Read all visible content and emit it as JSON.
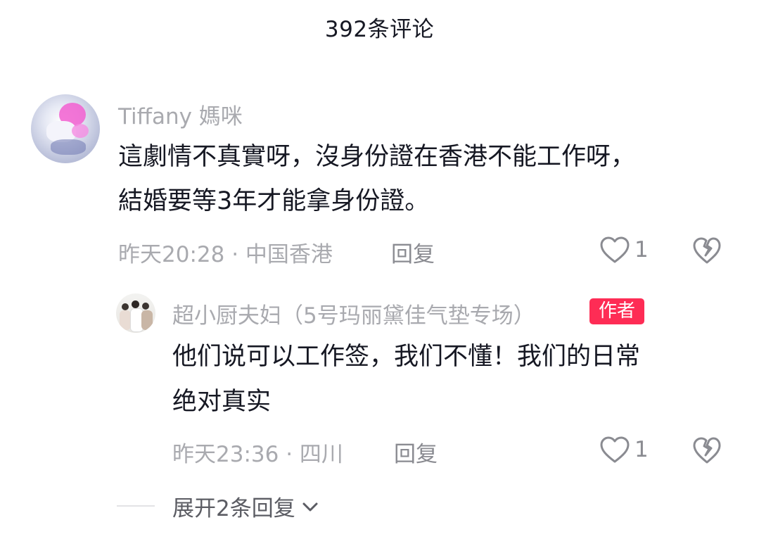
{
  "header": {
    "title": "392条评论"
  },
  "comment": {
    "username": "Tiffany 媽咪",
    "text_line1": "這劇情不真實呀，沒身份證在香港不能工作呀，",
    "text_line2": "結婚要等3年才能拿身份證。",
    "meta": "昨天20:28 · 中国香港",
    "reply_label": "回复",
    "like_count": "1",
    "like_icon": "heart-outline-icon",
    "dislike_icon": "broken-heart-icon"
  },
  "reply": {
    "username": "超小厨夫妇（5号玛丽黛佳气垫专场）",
    "badge": "作者",
    "badge_color": "#fe2c55",
    "text_line1": "他们说可以工作签，我们不懂！我们的日常",
    "text_line2": "绝对真实",
    "meta": "昨天23:36 · 四川",
    "reply_label": "回复",
    "like_count": "1",
    "like_icon": "heart-outline-icon",
    "dislike_icon": "broken-heart-icon"
  },
  "expand": {
    "label": "展开2条回复",
    "icon": "chevron-down-icon"
  }
}
